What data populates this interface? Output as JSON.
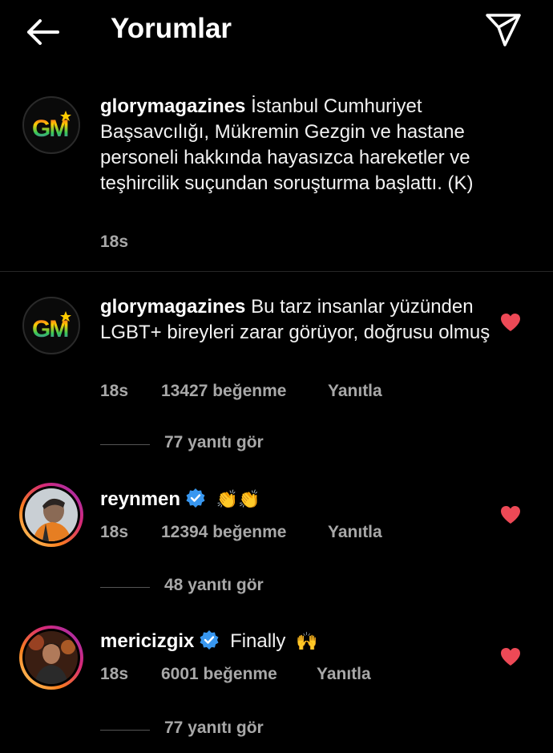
{
  "header": {
    "title": "Yorumlar",
    "back_icon": "arrow-left-icon",
    "share_icon": "paper-plane-icon"
  },
  "caption": {
    "username": "glorymagazines",
    "text": "İstanbul Cumhuriyet Başsavcılığı, Mükremin Gezgin ve hastane personeli hakkında hayasızca hareketler ve teşhircilik suçundan soruşturma başlattı. (K)",
    "time": "18s"
  },
  "comments": [
    {
      "username": "glorymagazines",
      "text": "Bu tarz insanlar yüzünden LGBT+ bireyleri zarar görüyor, doğrusu olmuş",
      "time": "18s",
      "likes": "13427 beğenme",
      "reply": "Yanıtla",
      "view_replies": "77 yanıtı gör"
    },
    {
      "username": "reynmen",
      "text": "👏👏",
      "time": "18s",
      "likes": "12394 beğenme",
      "reply": "Yanıtla",
      "view_replies": "48 yanıtı gör"
    },
    {
      "username": "mericizgix",
      "text": "Finally",
      "emoji": "🙌",
      "time": "18s",
      "likes": "6001 beğenme",
      "reply": "Yanıtla",
      "view_replies": "77 yanıtı gör"
    }
  ],
  "avatar_logo": "GM",
  "colors": {
    "background": "#000000",
    "like_heart": "#ed4956",
    "verified": "#3897f0",
    "secondary_text": "#a8a8a8"
  }
}
